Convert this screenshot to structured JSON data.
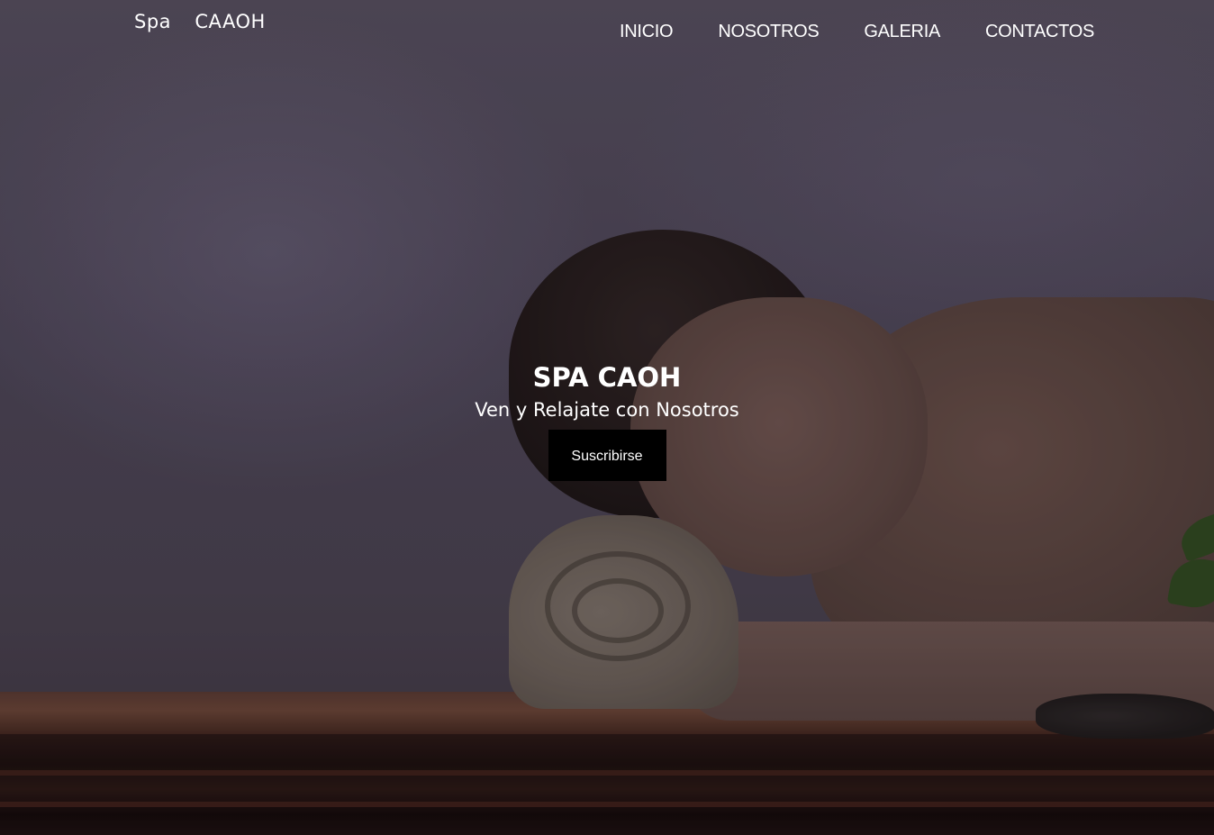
{
  "header": {
    "brand": "Spa  CAAOH",
    "nav": [
      {
        "label": "INICIO"
      },
      {
        "label": "NOSOTROS"
      },
      {
        "label": "GALERIA"
      },
      {
        "label": "CONTACTOS"
      }
    ]
  },
  "hero": {
    "title": "SPA CAOH",
    "subtitle": "Ven y Relajate con Nosotros",
    "cta_label": "Suscribirse"
  },
  "colors": {
    "text": "#ffffff",
    "cta_background": "#000000"
  }
}
